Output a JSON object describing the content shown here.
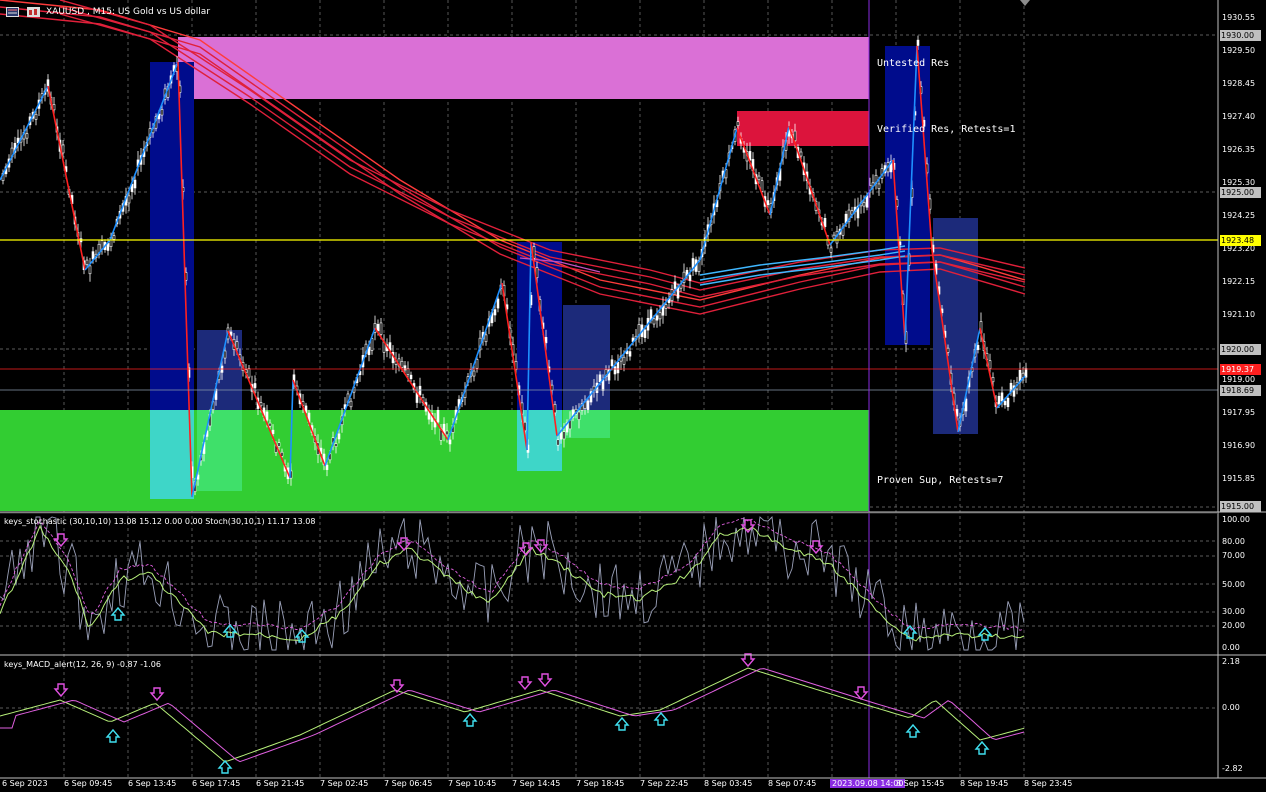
{
  "header": {
    "symbol_line": "XAUUSD , M15: US Gold vs US dollar",
    "icons": [
      "chart-window-icon",
      "toolbar-icon"
    ]
  },
  "price_axis": {
    "labels": [
      "1930.55",
      "1929.50",
      "1928.45",
      "1927.40",
      "1926.35",
      "1925.30",
      "1924.25",
      "1923.20",
      "1922.15",
      "1921.10",
      "1919.00",
      "1917.95",
      "1916.90",
      "1915.85"
    ],
    "levels": {
      "top": "1930.00",
      "mid": "1925.00",
      "low": "1920.00",
      "bottom": "1915.00"
    },
    "current_line": "1923.48",
    "bid": "1919.37",
    "ask": "1918.69"
  },
  "zones": {
    "untested": "Untested Res",
    "verified": "Verified Res, Retests=1",
    "proven": "Proven Sup, Retests=7"
  },
  "stoch_panel": {
    "title": "keys_stochastic (30,10,10) 13.08 15.12 0.00 0.00 Stoch(30,10,1) 11.17 13.08",
    "levels": [
      "100.00",
      "80.00",
      "70.00",
      "50.00",
      "30.00",
      "20.00",
      "0.00"
    ]
  },
  "macd_panel": {
    "title": "keys_MACD_alert(12, 26, 9) -0.87 -1.06",
    "levels": [
      "2.18",
      "0.00",
      "-2.82"
    ]
  },
  "time_axis": {
    "labels": [
      "6 Sep 2023",
      "6 Sep 09:45",
      "6 Sep 13:45",
      "6 Sep 17:45",
      "6 Sep 21:45",
      "7 Sep 02:45",
      "7 Sep 06:45",
      "7 Sep 10:45",
      "7 Sep 14:45",
      "7 Sep 18:45",
      "7 Sep 22:45",
      "8 Sep 03:45",
      "8 Sep 07:45",
      "2023.09.08 14:00",
      "8 Sep 15:45",
      "8 Sep 19:45",
      "8 Sep 23:45"
    ],
    "crosshair": "2023.09.08 14:00"
  },
  "colors": {
    "background": "#000000",
    "untested_zone": "#da70d6",
    "verified_zone": "#dc143c",
    "proven_zone": "#32cd32",
    "zigzag_up": "#1e90ff",
    "zigzag_down": "#ff2020",
    "horizontal_line": "#ffff00",
    "crosshair": "#8a2be2"
  }
}
